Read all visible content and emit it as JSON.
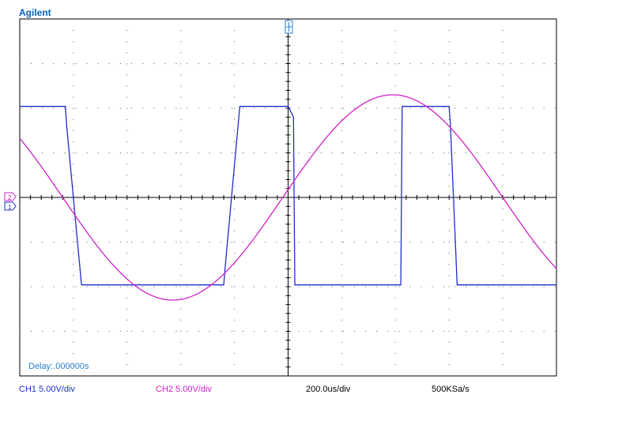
{
  "brand": "Agilent",
  "delay_label": "Delay:.000000s",
  "status": {
    "ch1": "CH1 5.00V/div",
    "ch2": "CH2 5.00V/div",
    "timebase": "200.0us/div",
    "sample_rate": "500KSa/s"
  },
  "colors": {
    "ch1": "#1f2fc8",
    "ch2": "#d020c8",
    "grid": "#000000",
    "text_blue": "#2a7fc8"
  },
  "icons": [
    "ch1-ground-marker-icon",
    "ch2-ground-marker-icon",
    "trigger-marker-icon"
  ],
  "chart_data": {
    "type": "line",
    "title": "",
    "xlabel": "",
    "ylabel": "",
    "x_unit": "us",
    "y_unit": "V",
    "xlim": [
      -1000,
      1000
    ],
    "ylim": [
      -20,
      20
    ],
    "x_divisions": 10,
    "y_divisions": 8,
    "grid": true,
    "series": [
      {
        "name": "CH1",
        "x": [
          -1000,
          -830,
          -825,
          -770,
          -760,
          -240,
          -235,
          -180,
          -175,
          0,
          20,
          25,
          410,
          420,
          425,
          600,
          605,
          630,
          640,
          1000
        ],
        "y": [
          10.2,
          10.2,
          8.0,
          -9.8,
          -9.8,
          -9.8,
          -8.0,
          10.2,
          10.2,
          10.2,
          9.0,
          -9.8,
          -9.8,
          -9.8,
          10.2,
          10.2,
          8.0,
          -9.8,
          -9.8,
          -9.8
        ]
      },
      {
        "name": "CH2",
        "kind": "sine",
        "amplitude": 11.5,
        "period_us": 1640,
        "phase_zero_cross_us": -20,
        "x_start": -1000,
        "x_end": 1000
      }
    ]
  }
}
